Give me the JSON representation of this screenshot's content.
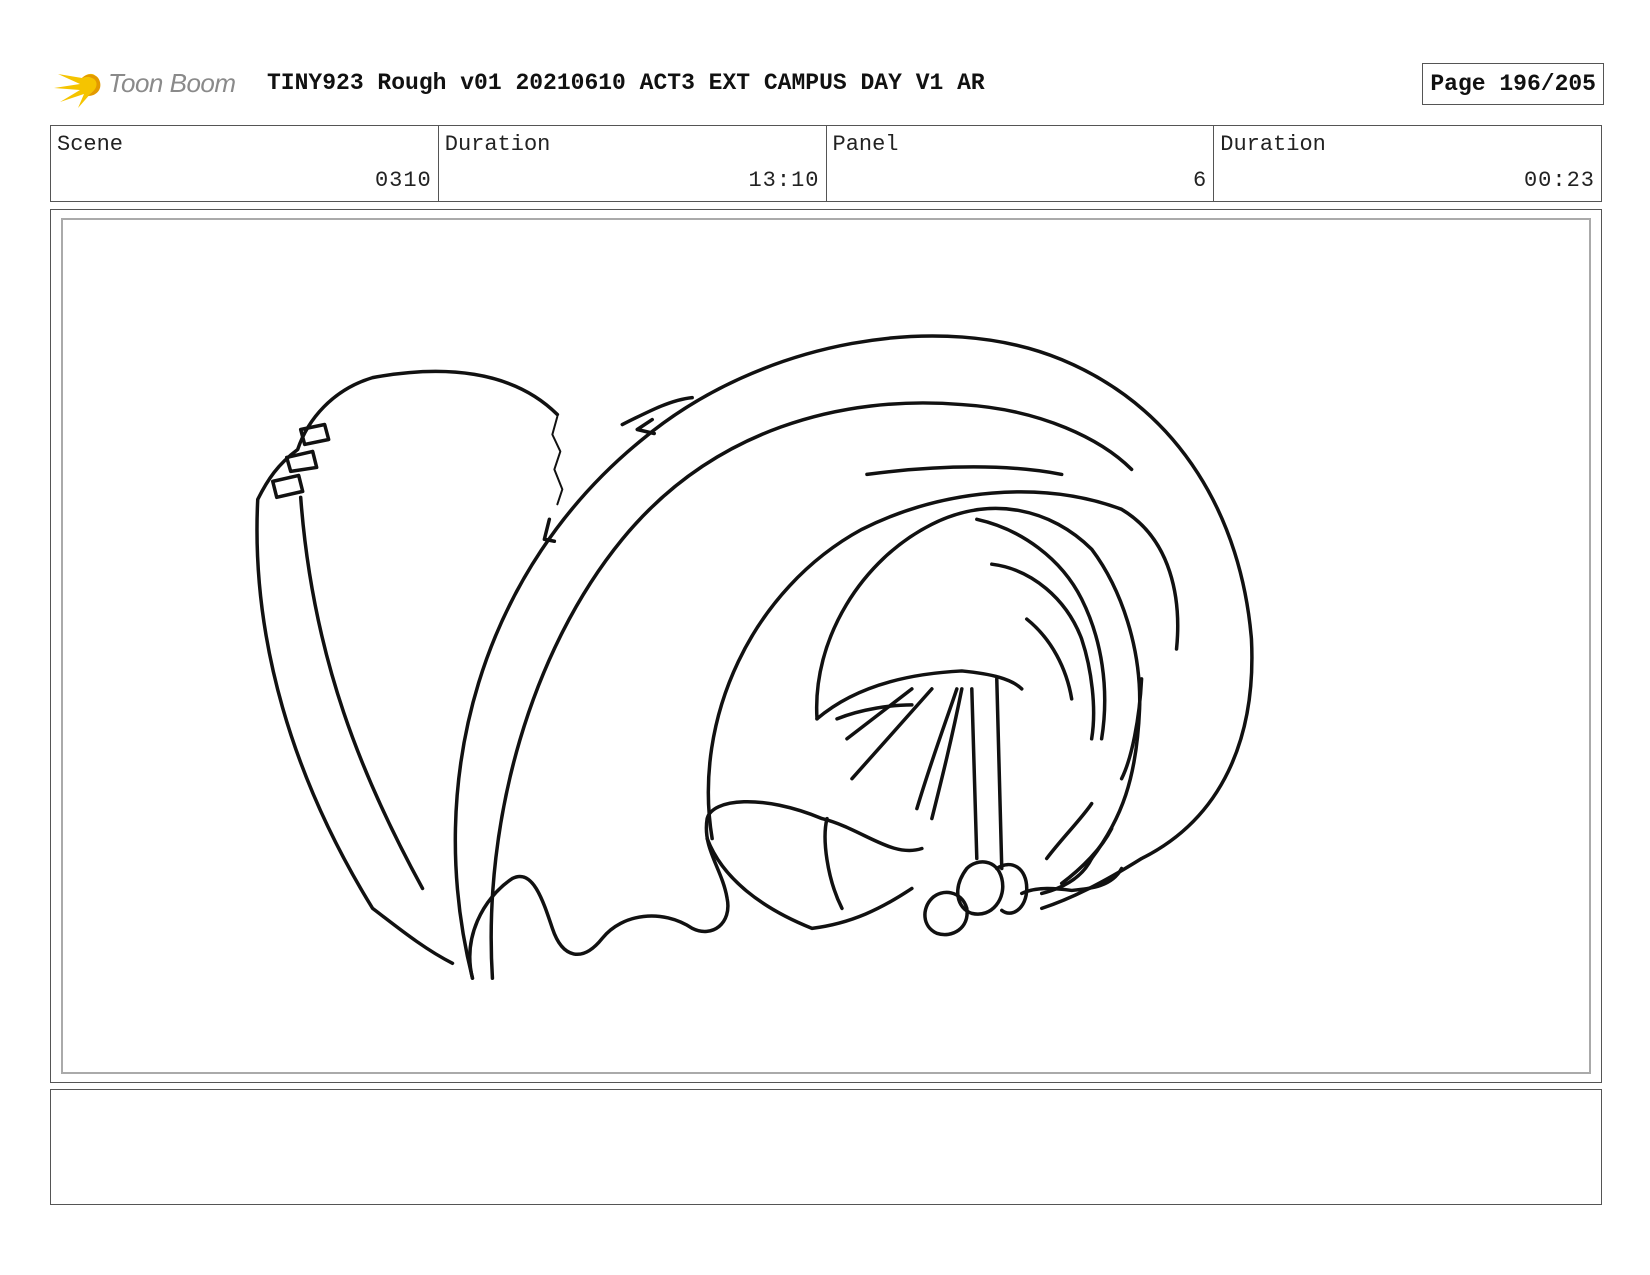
{
  "header": {
    "logo_text": "Toon Boom",
    "title": "TINY923 Rough v01 20210610 ACT3 EXT CAMPUS DAY V1 AR",
    "page": "Page 196/205"
  },
  "info": {
    "scene_label": "Scene",
    "scene_value": "0310",
    "scene_duration_label": "Duration",
    "scene_duration_value": "13:10",
    "panel_label": "Panel",
    "panel_value": "6",
    "panel_duration_label": "Duration",
    "panel_duration_value": "00:23"
  },
  "notes": {
    "text": ""
  }
}
